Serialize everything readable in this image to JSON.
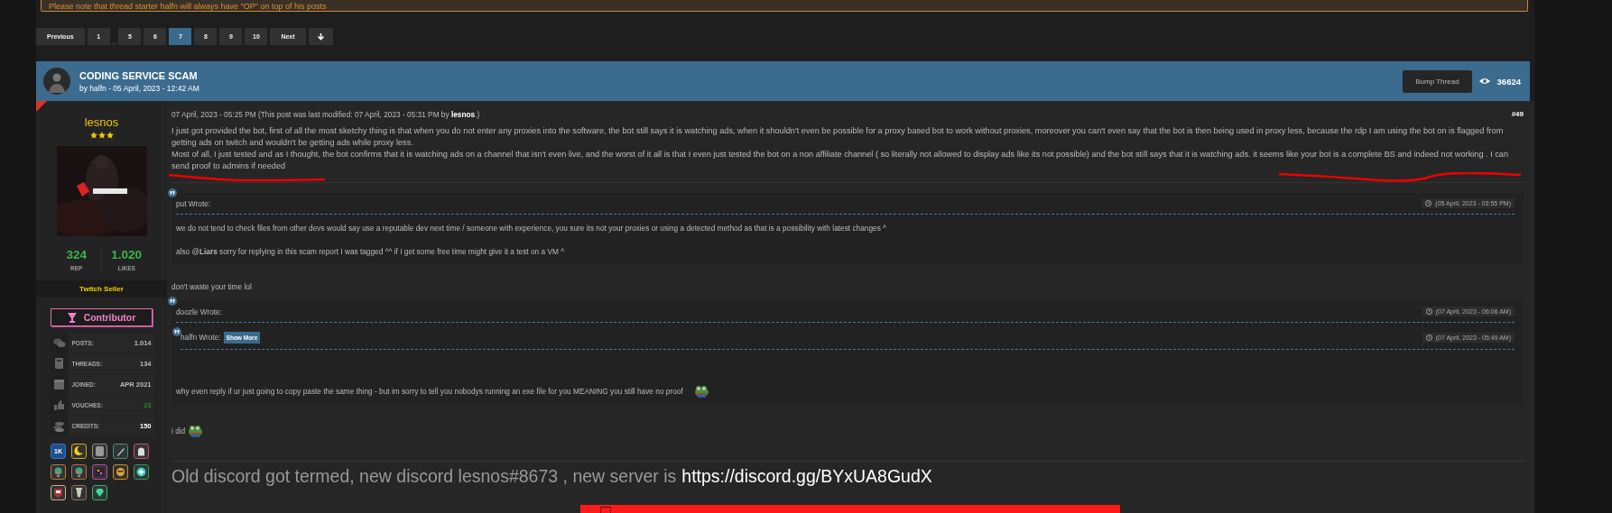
{
  "notice": "Please note that thread starter halfn will always have \"OP\" on top of his posts",
  "pagination": [
    {
      "kind": "page",
      "label": "Previous",
      "selected": false
    },
    {
      "kind": "page",
      "label": "1",
      "selected": false
    },
    {
      "kind": "gap",
      "label": "..."
    },
    {
      "kind": "page",
      "label": "5",
      "selected": false
    },
    {
      "kind": "page",
      "label": "6",
      "selected": false
    },
    {
      "kind": "page",
      "label": "7",
      "selected": true
    },
    {
      "kind": "page",
      "label": "8",
      "selected": false
    },
    {
      "kind": "page",
      "label": "9",
      "selected": false
    },
    {
      "kind": "page",
      "label": "10",
      "selected": false
    },
    {
      "kind": "page",
      "label": "Next",
      "selected": false
    },
    {
      "kind": "down",
      "selected": false
    }
  ],
  "thread": {
    "title": "CODING SERVICE SCAM",
    "byline": "by halfn - 05 April, 2023 - 12:42 AM",
    "bump": "Bump Thread",
    "views": "36624"
  },
  "user": {
    "name": "lesnos",
    "stars": 3,
    "rep": "324",
    "rep_label": "REP",
    "likes": "1.020",
    "likes_label": "LIKES",
    "title": "Twitch Seller",
    "rank": "Contributor",
    "stats": [
      {
        "label": "POSTS:",
        "value": "1.014",
        "color": "#bbbbbb"
      },
      {
        "label": "THREADS:",
        "value": "134",
        "color": "#bbbbbb"
      },
      {
        "label": "JOINED:",
        "value": "APR 2021",
        "color": "#bbbbbb"
      },
      {
        "label": "VOUCHES:",
        "value": "23",
        "color": "#1f8f1f"
      },
      {
        "label": "CREDITS:",
        "value": "150",
        "color": "#ffffff"
      }
    ],
    "badges": [
      {
        "kind": "text",
        "label": "1K",
        "color": "#2f78c0"
      },
      {
        "kind": "moon",
        "color": "#d4b000"
      },
      {
        "kind": "scroll",
        "color": "#8a8a8a"
      },
      {
        "kind": "pen",
        "color": "#4a8a80"
      },
      {
        "kind": "ghost",
        "color": "#c05070"
      },
      {
        "kind": "globe",
        "color": "#c07a3a"
      },
      {
        "kind": "globe",
        "color": "#b8703a"
      },
      {
        "kind": "sparkle",
        "color": "#b050a0"
      },
      {
        "kind": "face",
        "color": "#d08a20"
      },
      {
        "kind": "plus",
        "color": "#2a9a5a"
      },
      {
        "kind": "shield",
        "color": "#c8b090"
      },
      {
        "kind": "deer",
        "color": "#8a7060"
      },
      {
        "kind": "gem",
        "color": "#30b070"
      }
    ]
  },
  "post": {
    "date": "07 April, 2023 - 05:25 PM (This post was last modified: 07 April, 2023 - 05:31 PM by **lesnos**.)",
    "number": "#49",
    "paragraphs": [
      "I just got provided the bot, first of all the most sketchy thing is that when you do not enter any proxies into the software, the bot still says it is watching ads, when it shouldn't even be possible for a proxy based bot to work without proxies, moreover you can't even say that the bot is then being used in proxy less, because the rdp I am using the bot on is flagged from getting ads on twitch and wouldn't be getting ads while proxy less.",
      "Most of all, I just tested and as I thought, the bot confirms that it is watching ads on a channel that isn't even live, and the worst of it all is that I even just tested the bot on a non affiliate channel ( so literally not allowed to display ads like its not possible) and the bot still says that it is watching ads. it seems like your bot is a complete BS and indeed not working . I can send proof to admins if needed"
    ],
    "blocks": [
      {
        "kind": "quote",
        "author": "put Wrote:",
        "time": "(05 April, 2023 - 03:55 PM)",
        "paragraphs": [
          "we do not tend to check files from other devs would say use a reputable dev next time / someone with experience, you sure its not your proxies or using a detected method as that is a possibility with latest changes ^",
          "also @**Liars** sorry for replying in this scam report I was tagged ^^ if I get some free time might give it a test on a VM ^"
        ]
      },
      {
        "kind": "text",
        "text": "don't waste your time lol"
      },
      {
        "kind": "quote",
        "author": "doozle Wrote:",
        "time": "(07 April, 2023 - 06:06 AM)",
        "nested": {
          "author": "halfn Wrote:",
          "show_more": "Show More",
          "time": "(07 April, 2023 - 05:49 AM)"
        },
        "paragraphs": [
          "why even reply if ur just going to copy paste the same thing - but im sorry to tell you nobodys running an exe file for you MEANING you still have no proof"
        ],
        "emoji": true
      },
      {
        "kind": "text",
        "text": "i did",
        "emoji": true
      }
    ],
    "signature": {
      "text": "Old discord got termed, new discord lesnos#8673 , new server is",
      "link": "https://discord.gg/BYxUA8GudX"
    }
  }
}
